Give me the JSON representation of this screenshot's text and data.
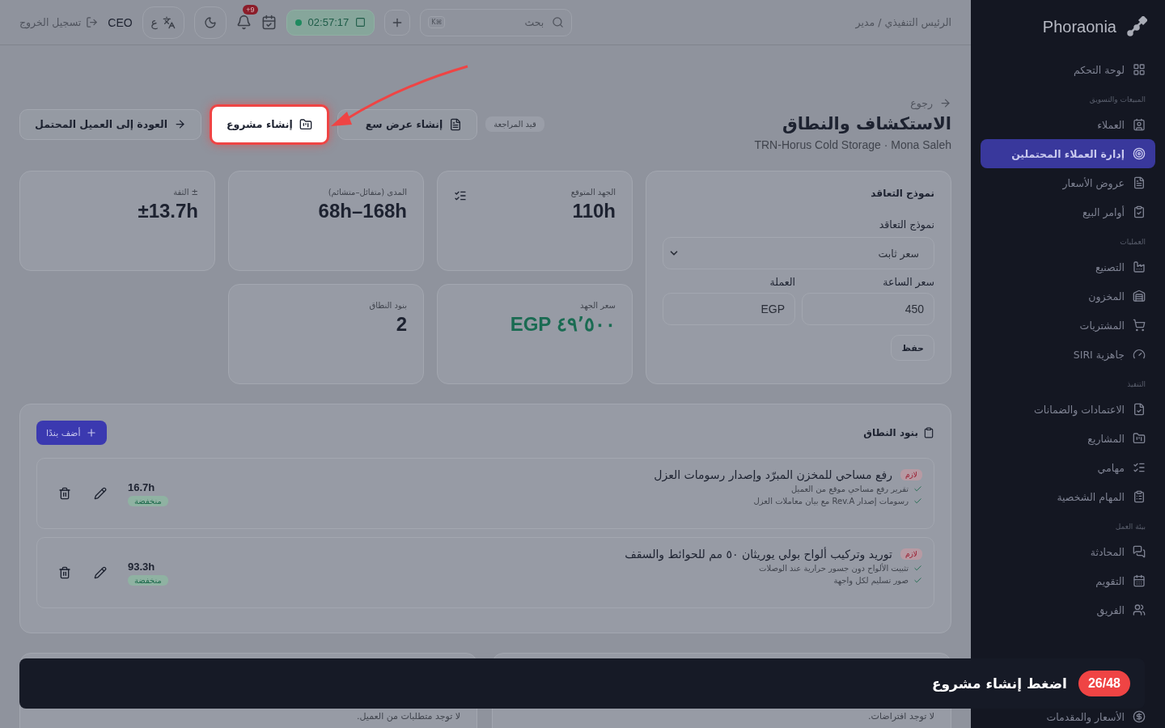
{
  "sidebar": {
    "brand": "Phoraonia",
    "sections": [
      {
        "items": [
          {
            "label": "لوحة التحكم",
            "selected": false
          }
        ]
      },
      {
        "label": "المبيعات والتسويق",
        "items": [
          {
            "label": "العملاء",
            "selected": false
          },
          {
            "label": "إدارة العملاء المحتملين",
            "selected": true
          },
          {
            "label": "عروض الأسعار",
            "selected": false
          },
          {
            "label": "أوامر البيع",
            "selected": false
          }
        ]
      },
      {
        "label": "العمليات",
        "items": [
          {
            "label": "التصنيع",
            "selected": false
          },
          {
            "label": "المخزون",
            "selected": false
          },
          {
            "label": "المشتريات",
            "selected": false
          },
          {
            "label": "جاهزية SIRI",
            "selected": false
          }
        ]
      },
      {
        "label": "التنفيذ",
        "items": [
          {
            "label": "الاعتمادات والضمانات",
            "selected": false
          },
          {
            "label": "المشاريع",
            "selected": false
          },
          {
            "label": "مهامي",
            "selected": false
          },
          {
            "label": "المهام الشخصية",
            "selected": false
          }
        ]
      },
      {
        "label": "بيئة العمل",
        "items": [
          {
            "label": "المحادثة",
            "selected": false
          },
          {
            "label": "التقويم",
            "selected": false
          },
          {
            "label": "الفريق",
            "selected": false
          }
        ]
      },
      {
        "items": [
          {
            "label": "الأسعار والمقدمات",
            "selected": false
          }
        ]
      }
    ]
  },
  "topbar": {
    "breadcrumb": "الرئيس التنفيذي / مدير",
    "search": {
      "placeholder": "بحث",
      "shortcut": "⌘K"
    },
    "timer": "02:57:17",
    "notifications": "+9",
    "language": "ع",
    "user": "CEO",
    "logout": "تسجيل الخروج"
  },
  "header": {
    "back": "رجوع",
    "title": "الاستكشاف والنطاق",
    "subtitle": "TRN-Horus Cold Storage · Mona Saleh",
    "status": "قيد المراجعة",
    "actions": [
      {
        "label": "إنشاء عرض سع",
        "highlighted": false,
        "kind": "quote"
      },
      {
        "label": "إنشاء مشروع",
        "highlighted": true,
        "kind": "project"
      },
      {
        "label": "العودة إلى العميل المحتمل",
        "highlighted": false,
        "kind": "back"
      }
    ]
  },
  "stats": [
    {
      "label": "الجهد المتوقع",
      "value": "110h",
      "kind": "plain"
    },
    {
      "label": "المدى (متفائل–متشائم)",
      "value": "68h–168h",
      "kind": "plain"
    },
    {
      "label": "± الثقة",
      "value": "±13.7h",
      "kind": "plain"
    },
    {
      "label": "سعر الجهد",
      "value": "٤٩٬٥٠٠ EGP",
      "kind": "money"
    },
    {
      "label": "بنود النطاق",
      "value": "2",
      "kind": "plain"
    }
  ],
  "contract": {
    "title": "نموذج التعاقد",
    "model_label": "نموذج التعاقد",
    "model_value": "سعر ثابت",
    "rate_label": "سعر الساعة",
    "rate_value": "450",
    "currency_label": "العملة",
    "currency_value": "EGP",
    "save": "حفظ"
  },
  "scope": {
    "title": "بنود النطاق",
    "add": "أضف بندًا",
    "items": [
      {
        "tag": "لازم",
        "title": "رفع مساحي للمخزن المبرّد وإصدار رسومات العزل",
        "hours": "16.7h",
        "priority": "منخفضة",
        "checks": [
          "تقرير رفع مساحي موقع من العميل",
          "رسومات إصدار Rev.A مع بيان معاملات العزل"
        ]
      },
      {
        "tag": "لازم",
        "title": "توريد وتركيب ألواح بولي يوريثان ٥٠ مم للحوائط والسقف",
        "hours": "93.3h",
        "priority": "منخفضة",
        "checks": [
          "تثبيت الألواح دون جسور حرارية عند الوصلات",
          "صور تسليم لكل واجهة"
        ]
      }
    ]
  },
  "lower_cards": [
    {
      "empty": "لا توجد افتراضات."
    },
    {
      "empty": "لا توجد متطلبات من العميل."
    }
  ],
  "tour": {
    "text": "اضغط إنشاء مشروع",
    "step": "26/48"
  }
}
